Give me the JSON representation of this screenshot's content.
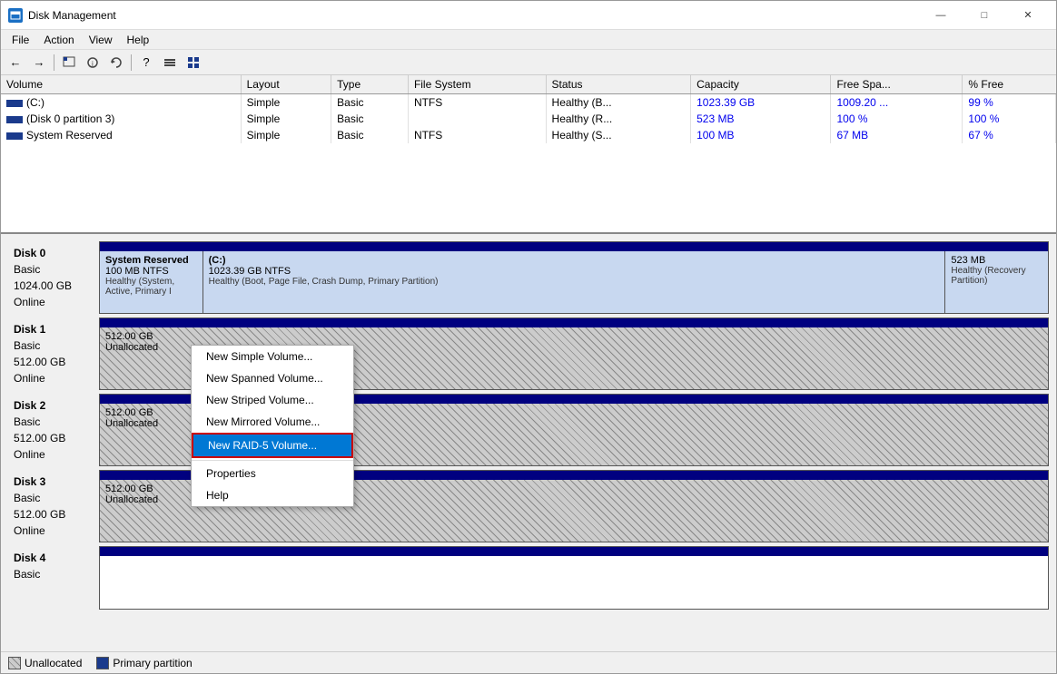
{
  "window": {
    "title": "Disk Management",
    "icon": "💾"
  },
  "title_buttons": {
    "minimize": "—",
    "maximize": "□",
    "close": "✕"
  },
  "menu": {
    "items": [
      "File",
      "Action",
      "View",
      "Help"
    ]
  },
  "toolbar": {
    "buttons": [
      "←",
      "→",
      "⬜",
      "🔧",
      "⬜",
      "📋",
      "⬜",
      "⬜"
    ]
  },
  "volume_table": {
    "headers": [
      "Volume",
      "Layout",
      "Type",
      "File System",
      "Status",
      "Capacity",
      "Free Spa...",
      "% Free"
    ],
    "rows": [
      {
        "volume": "(C:)",
        "layout": "Simple",
        "type": "Basic",
        "fs": "NTFS",
        "status": "Healthy (B...",
        "capacity": "1023.39 GB",
        "free": "1009.20 ...",
        "pct_free": "99 %"
      },
      {
        "volume": "(Disk 0 partition 3)",
        "layout": "Simple",
        "type": "Basic",
        "fs": "",
        "status": "Healthy (R...",
        "capacity": "523 MB",
        "free": "100 %",
        "pct_free": "100 %"
      },
      {
        "volume": "System Reserved",
        "layout": "Simple",
        "type": "Basic",
        "fs": "NTFS",
        "status": "Healthy (S...",
        "capacity": "100 MB",
        "free": "67 MB",
        "pct_free": "67 %"
      }
    ]
  },
  "disks": [
    {
      "name": "Disk 0",
      "type": "Basic",
      "size": "1024.00 GB",
      "status": "Online",
      "partitions": [
        {
          "name": "System Reserved",
          "size": "100 MB NTFS",
          "status": "Healthy (System, Active, Primary I",
          "type": "primary",
          "flex": 1
        },
        {
          "name": "(C:)",
          "size": "1023.39 GB NTFS",
          "status": "Healthy (Boot, Page File, Crash Dump, Primary Partition)",
          "type": "primary",
          "flex": 8
        },
        {
          "name": "",
          "size": "523 MB",
          "status": "Healthy (Recovery Partition)",
          "type": "recovery",
          "flex": 1
        }
      ]
    },
    {
      "name": "Disk 1",
      "type": "Basic",
      "size": "512.00 GB",
      "status": "Online",
      "partitions": [
        {
          "name": "512.00 GB",
          "size": "Unallocated",
          "status": "",
          "type": "unallocated",
          "flex": 1
        }
      ]
    },
    {
      "name": "Disk 2",
      "type": "Basic",
      "size": "512.00 GB",
      "status": "Online",
      "partitions": [
        {
          "name": "512.00 GB",
          "size": "Unallocated",
          "status": "",
          "type": "unallocated",
          "flex": 1
        }
      ]
    },
    {
      "name": "Disk 3",
      "type": "Basic",
      "size": "512.00 GB",
      "status": "Online",
      "partitions": [
        {
          "name": "512.00 GB",
          "size": "Unallocated",
          "status": "",
          "type": "unallocated",
          "flex": 1
        }
      ]
    },
    {
      "name": "Disk 4",
      "type": "Basic",
      "size": "",
      "status": "",
      "partitions": []
    }
  ],
  "context_menu": {
    "items": [
      {
        "label": "New Simple Volume...",
        "type": "item"
      },
      {
        "label": "New Spanned Volume...",
        "type": "item"
      },
      {
        "label": "New Striped Volume...",
        "type": "item"
      },
      {
        "label": "New Mirrored Volume...",
        "type": "item"
      },
      {
        "label": "New RAID-5 Volume...",
        "type": "item",
        "highlighted": true
      },
      {
        "type": "sep"
      },
      {
        "label": "Properties",
        "type": "item"
      },
      {
        "label": "Help",
        "type": "item"
      }
    ]
  },
  "status_bar": {
    "unallocated_label": "Unallocated",
    "primary_label": "Primary partition"
  }
}
